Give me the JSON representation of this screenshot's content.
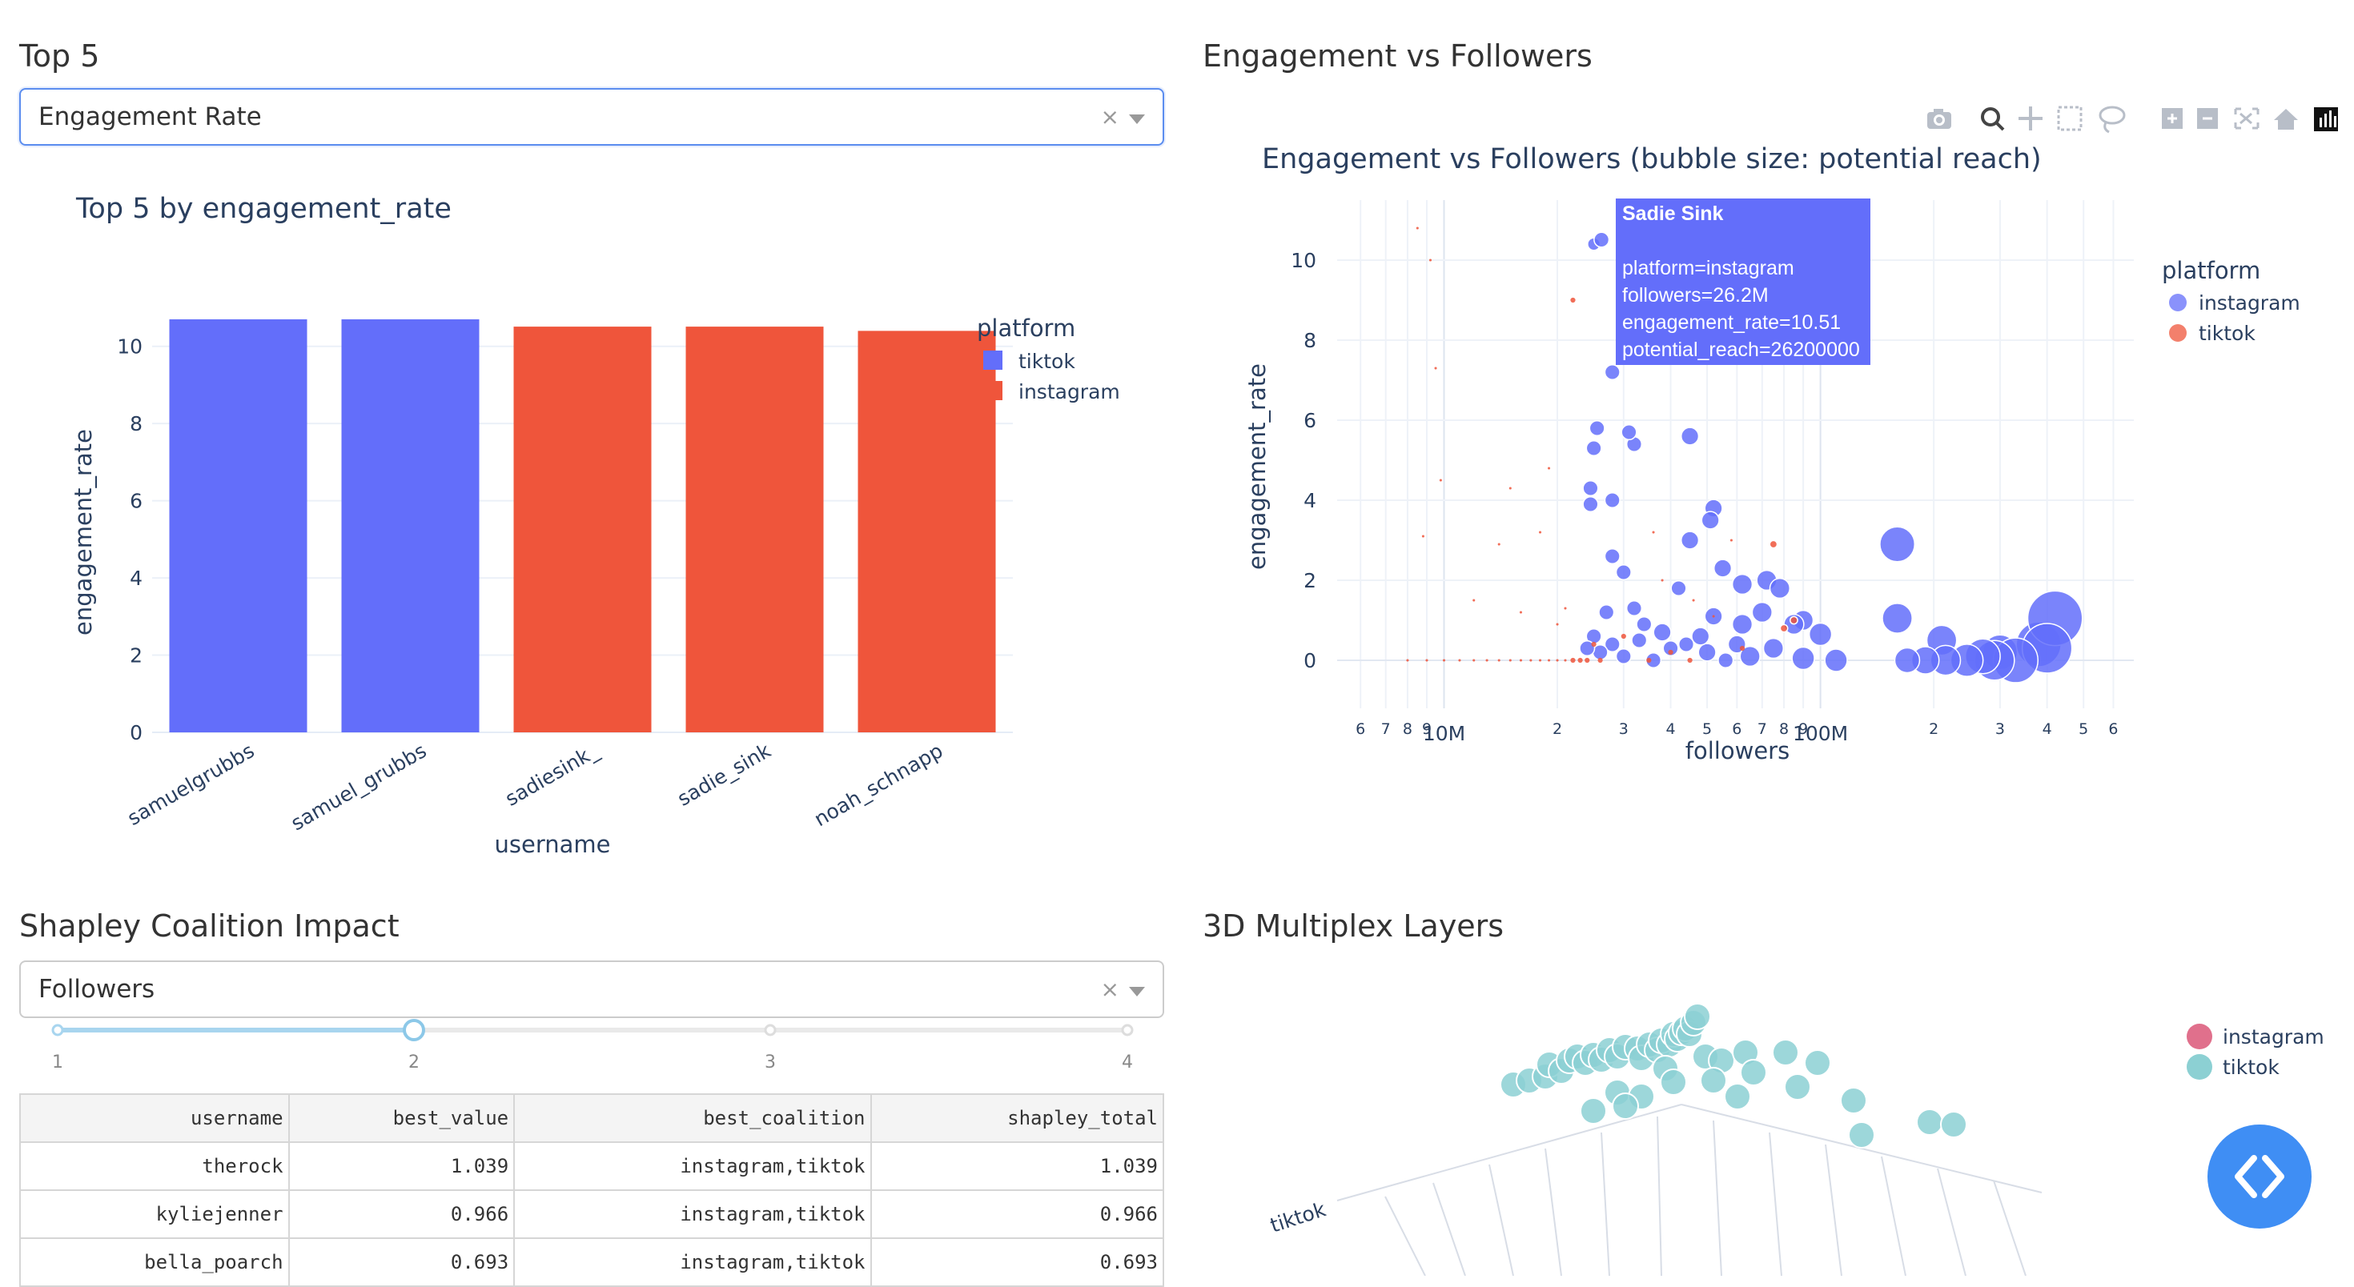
{
  "top5": {
    "section_title": "Top 5",
    "dropdown_value": "Engagement Rate",
    "clear_symbol": "×",
    "chart_data": {
      "type": "bar",
      "title": "Top 5 by engagement_rate",
      "xlabel": "username",
      "ylabel": "engagement_rate",
      "categories": [
        "samuelgrubbs",
        "samuel_grubbs",
        "sadiesink_",
        "sadie_sink",
        "noah_schnapp"
      ],
      "values": [
        10.7,
        10.7,
        10.51,
        10.51,
        10.4
      ],
      "platforms": [
        "tiktok",
        "tiktok",
        "instagram",
        "instagram",
        "instagram"
      ],
      "ylim": [
        0,
        11.3
      ],
      "yticks": [
        "0",
        "2",
        "4",
        "6",
        "8",
        "10"
      ],
      "legend_title": "platform",
      "legend": [
        {
          "name": "tiktok",
          "color": "#636efa"
        },
        {
          "name": "instagram",
          "color": "#ef553b"
        }
      ]
    }
  },
  "engagement": {
    "section_title": "Engagement vs Followers",
    "chart_data": {
      "type": "scatter",
      "title": "Engagement vs Followers (bubble size: potential reach)",
      "xlabel": "followers",
      "ylabel": "engagement_rate",
      "log_x": true,
      "ylim": [
        -1.2,
        11.5
      ],
      "yticks": [
        "0",
        "2",
        "4",
        "6",
        "8",
        "10"
      ],
      "xtick_labels": [
        "6",
        "7",
        "8",
        "9",
        "10M",
        "2",
        "3",
        "4",
        "5",
        "6",
        "7",
        "8",
        "9",
        "100M",
        "2",
        "3",
        "4",
        "5",
        "6"
      ],
      "legend_title": "platform",
      "legend": [
        {
          "name": "instagram",
          "color": "#636efa"
        },
        {
          "name": "tiktok",
          "color": "#ef553b"
        }
      ],
      "series": [
        {
          "name": "instagram",
          "color": "#636efa",
          "points": [
            [
              25000000.0,
              10.4
            ],
            [
              26200000.0,
              10.51
            ],
            [
              28000000.0,
              7.2
            ],
            [
              25500000.0,
              5.8
            ],
            [
              25000000.0,
              5.3
            ],
            [
              32000000.0,
              5.4
            ],
            [
              31000000.0,
              5.7
            ],
            [
              45000000.0,
              5.6
            ],
            [
              24500000.0,
              4.3
            ],
            [
              24500000.0,
              3.9
            ],
            [
              28000000.0,
              4.0
            ],
            [
              52000000.0,
              3.8
            ],
            [
              51000000.0,
              3.5
            ],
            [
              45000000.0,
              3.0
            ],
            [
              28000000.0,
              2.6
            ],
            [
              30000000.0,
              2.2
            ],
            [
              42000000.0,
              1.8
            ],
            [
              55000000.0,
              2.3
            ],
            [
              62000000.0,
              1.9
            ],
            [
              72000000.0,
              2.0
            ],
            [
              78000000.0,
              1.8
            ],
            [
              70000000.0,
              1.2
            ],
            [
              52000000.0,
              1.1
            ],
            [
              90000000.0,
              1.0
            ],
            [
              100000000.0,
              0.65
            ],
            [
              160000000.0,
              1.05
            ],
            [
              160000000.0,
              2.9
            ],
            [
              210000000.0,
              0.5
            ],
            [
              300000000.0,
              0.2
            ],
            [
              380000000.0,
              0.4
            ],
            [
              420000000.0,
              1.05
            ],
            [
              400000000.0,
              0.3
            ],
            [
              330000000.0,
              0.0
            ],
            [
              290000000.0,
              0.0
            ],
            [
              270000000.0,
              0.1
            ],
            [
              245000000.0,
              0.0
            ],
            [
              215000000.0,
              0.0
            ],
            [
              190000000.0,
              0.0
            ],
            [
              170000000.0,
              0.0
            ],
            [
              110000000.0,
              0.0
            ],
            [
              75000000.0,
              0.3
            ],
            [
              60000000.0,
              0.4
            ],
            [
              56000000.0,
              0.0
            ],
            [
              50000000.0,
              0.2
            ],
            [
              44000000.0,
              0.4
            ],
            [
              40000000.0,
              0.3
            ],
            [
              36000000.0,
              0.0
            ],
            [
              33000000.0,
              0.5
            ],
            [
              30000000.0,
              0.1
            ],
            [
              28000000.0,
              0.4
            ],
            [
              26000000.0,
              0.2
            ],
            [
              25000000.0,
              0.6
            ],
            [
              24000000.0,
              0.3
            ],
            [
              27000000.0,
              1.2
            ],
            [
              32000000.0,
              1.3
            ],
            [
              34000000.0,
              0.9
            ],
            [
              38000000.0,
              0.7
            ],
            [
              48000000.0,
              0.6
            ],
            [
              65000000.0,
              0.1
            ],
            [
              85000000.0,
              0.9
            ],
            [
              90000000.0,
              0.05
            ],
            [
              62000000.0,
              0.9
            ]
          ],
          "sizes": [
            5,
            6,
            6,
            6,
            6,
            6,
            6,
            7,
            6,
            6,
            6,
            7,
            7,
            7,
            6,
            6,
            6,
            7,
            8,
            8,
            8,
            8,
            7,
            8,
            9,
            12,
            14,
            12,
            14,
            18,
            22,
            20,
            18,
            16,
            14,
            13,
            12,
            11,
            10,
            9,
            8,
            7,
            6,
            7,
            6,
            6,
            6,
            6,
            6,
            6,
            6,
            6,
            6,
            6,
            6,
            6,
            7,
            7,
            8,
            8,
            9,
            8
          ]
        },
        {
          "name": "tiktok",
          "color": "#ef553b",
          "points": [
            [
              22000000.0,
              9.0
            ],
            [
              8500000.0,
              10.8
            ],
            [
              9200000.0,
              10.0
            ],
            [
              9500000.0,
              7.3
            ],
            [
              9800000.0,
              4.5
            ],
            [
              8800000.0,
              3.1
            ],
            [
              14000000.0,
              2.9
            ],
            [
              15000000.0,
              4.3
            ],
            [
              18000000.0,
              3.2
            ],
            [
              19000000.0,
              4.8
            ],
            [
              12000000.0,
              1.5
            ],
            [
              16000000.0,
              1.2
            ],
            [
              20000000.0,
              0.9
            ],
            [
              21000000.0,
              1.3
            ],
            [
              36000000.0,
              3.2
            ],
            [
              38000000.0,
              2.0
            ],
            [
              46000000.0,
              1.5
            ],
            [
              52000000.0,
              1.1
            ],
            [
              58000000.0,
              3.0
            ],
            [
              75000000.0,
              2.9
            ],
            [
              80000000.0,
              0.8
            ],
            [
              85000000.0,
              1.0
            ],
            [
              25000000.0,
              0.4
            ],
            [
              30000000.0,
              0.6
            ],
            [
              40000000.0,
              0.2
            ],
            [
              62000000.0,
              0.3
            ],
            [
              8000000.0,
              0.0
            ],
            [
              9000000.0,
              0.0
            ],
            [
              10000000.0,
              0.0
            ],
            [
              11000000.0,
              0.0
            ],
            [
              12000000.0,
              0.0
            ],
            [
              13000000.0,
              0.0
            ],
            [
              14000000.0,
              0.0
            ],
            [
              15000000.0,
              0.0
            ],
            [
              16000000.0,
              0.0
            ],
            [
              17000000.0,
              0.0
            ],
            [
              18000000.0,
              0.0
            ],
            [
              19000000.0,
              0.0
            ],
            [
              20000000.0,
              0.0
            ],
            [
              21000000.0,
              0.0
            ],
            [
              22000000.0,
              0.0
            ],
            [
              23000000.0,
              0.0
            ],
            [
              24000000.0,
              0.0
            ],
            [
              26000000.0,
              0.0
            ],
            [
              35000000.0,
              0.0
            ],
            [
              45000000.0,
              0.0
            ]
          ],
          "sizes": [
            2,
            1,
            1,
            1,
            1,
            1,
            1,
            1,
            1,
            1,
            1,
            1,
            1,
            1,
            1,
            1,
            1,
            1,
            1,
            3,
            3,
            3,
            2,
            2,
            2,
            2,
            1,
            1,
            1,
            1,
            1,
            1,
            1,
            1,
            1,
            1,
            1,
            1,
            1,
            1,
            2,
            2,
            2,
            2,
            2,
            2
          ]
        }
      ],
      "tooltip": {
        "name": "Sadie Sink",
        "lines": [
          "platform=instagram",
          "followers=26.2M",
          "engagement_rate=10.51",
          "potential_reach=26200000"
        ]
      }
    },
    "modebar": [
      "camera-icon",
      "zoom-icon",
      "pan-icon",
      "box-select-icon",
      "lasso-icon",
      "zoom-in-icon",
      "zoom-out-icon",
      "autoscale-icon",
      "reset-icon",
      "plotly-logo-icon"
    ]
  },
  "shapley": {
    "section_title": "Shapley Coalition Impact",
    "dropdown_value": "Followers",
    "clear_symbol": "×",
    "slider": {
      "min": 1,
      "max": 4,
      "value": 2,
      "marks": [
        "1",
        "2",
        "3",
        "4"
      ]
    },
    "table": {
      "columns": [
        "username",
        "best_value",
        "best_coalition",
        "shapley_total"
      ],
      "rows": [
        [
          "therock",
          "1.039",
          "instagram,tiktok",
          "1.039"
        ],
        [
          "kyliejenner",
          "0.966",
          "instagram,tiktok",
          "0.966"
        ],
        [
          "bella_poarch",
          "0.693",
          "instagram,tiktok",
          "0.693"
        ]
      ]
    }
  },
  "multiplex": {
    "section_title": "3D Multiplex Layers",
    "axis_label": "tiktok",
    "legend": [
      {
        "name": "instagram",
        "color": "#e0708c"
      },
      {
        "name": "tiktok",
        "color": "#8cd0d3"
      }
    ]
  }
}
